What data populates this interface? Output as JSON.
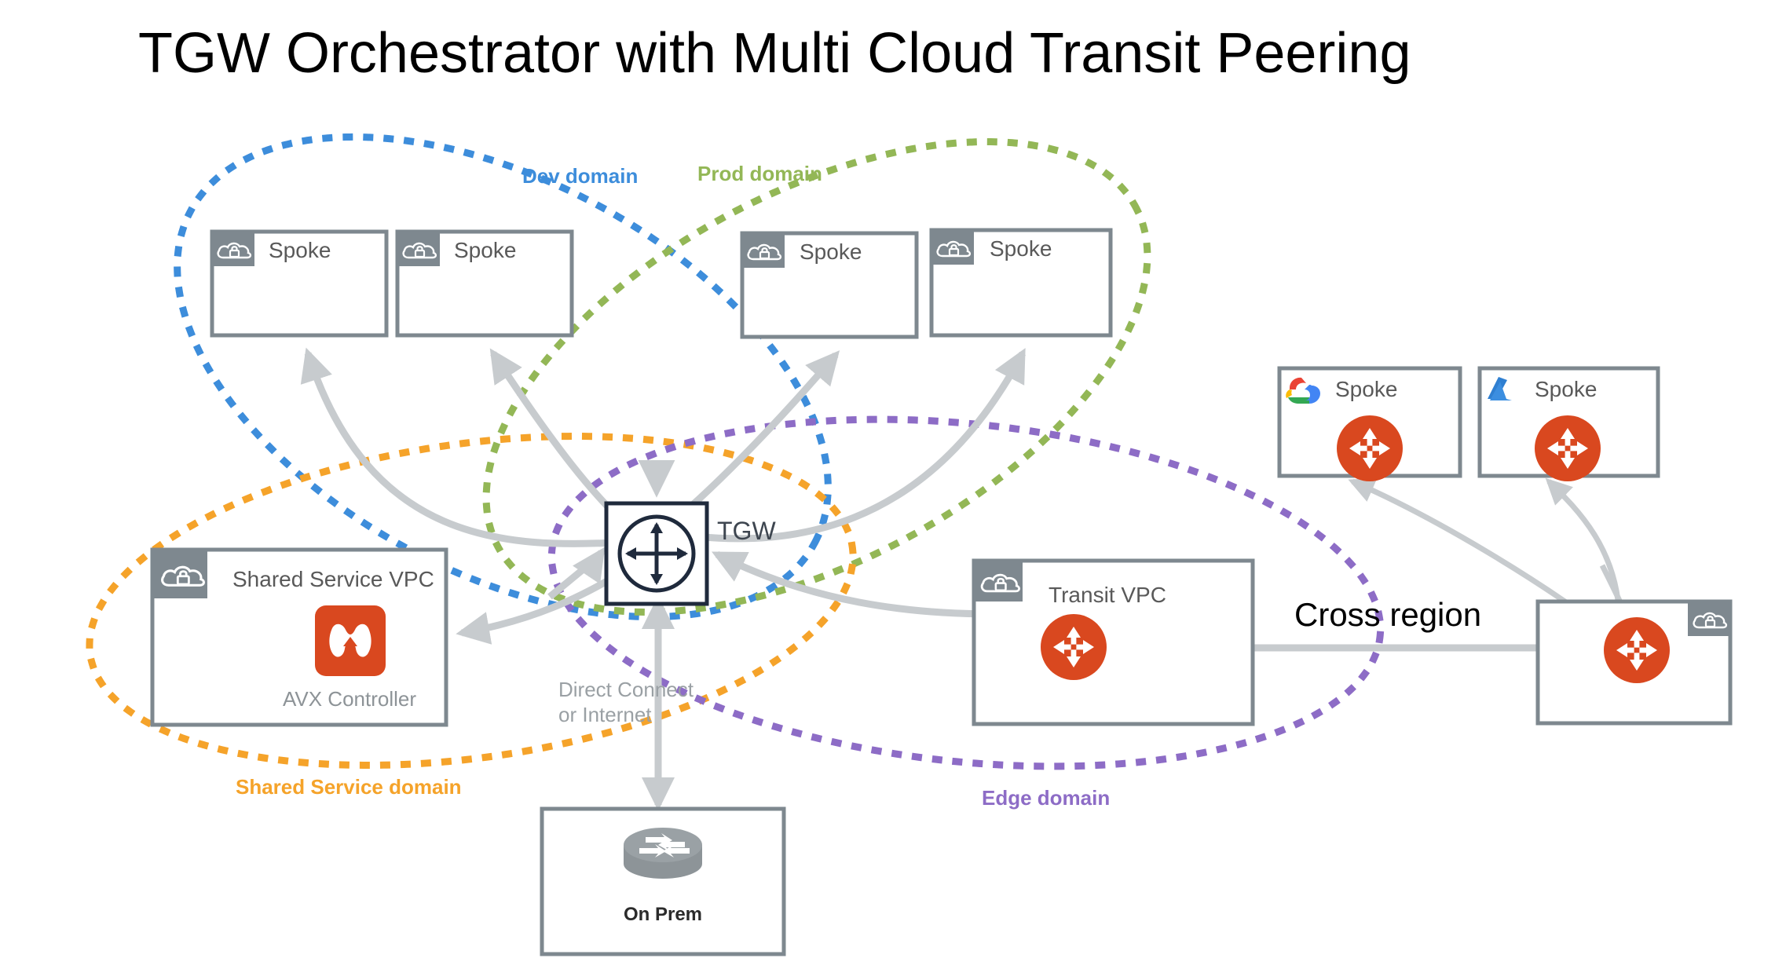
{
  "title": "TGW Orchestrator with Multi Cloud Transit Peering",
  "domains": [
    {
      "key": "dev",
      "label": "Dev domain",
      "color": "#3d8ddb"
    },
    {
      "key": "prod",
      "label": "Prod domain",
      "color": "#93b756"
    },
    {
      "key": "shared",
      "label": "Shared Service domain",
      "color": "#f5a32a"
    },
    {
      "key": "edge",
      "label": "Edge domain",
      "color": "#8d6cc6"
    }
  ],
  "nodes": {
    "dev_spoke_1": {
      "label": "Spoke",
      "icon": "aws-vpc-cloud-lock-icon"
    },
    "dev_spoke_2": {
      "label": "Spoke",
      "icon": "aws-vpc-cloud-lock-icon"
    },
    "prod_spoke_1": {
      "label": "Spoke",
      "icon": "aws-vpc-cloud-lock-icon"
    },
    "prod_spoke_2": {
      "label": "Spoke",
      "icon": "aws-vpc-cloud-lock-icon"
    },
    "gcp_spoke": {
      "label": "Spoke",
      "icon": "google-cloud-icon",
      "gateway": "aviatrix-gateway-icon"
    },
    "azure_spoke": {
      "label": "Spoke",
      "icon": "azure-icon",
      "gateway": "aviatrix-gateway-icon"
    },
    "remote_vpc": {
      "label": "",
      "icon": "aws-vpc-cloud-lock-icon",
      "gateway": "aviatrix-gateway-icon"
    },
    "shared_vpc": {
      "label": "Shared Service VPC",
      "icon": "aws-vpc-cloud-lock-icon",
      "caption": "AVX Controller",
      "app_icon": "aviatrix-controller-icon"
    },
    "transit_vpc": {
      "label": "Transit VPC",
      "icon": "aws-vpc-cloud-lock-icon",
      "gateway": "aviatrix-gateway-icon"
    },
    "tgw": {
      "label": "TGW",
      "icon": "transit-gateway-icon"
    },
    "on_prem": {
      "label": "On Prem",
      "icon": "router-icon"
    }
  },
  "annotations": {
    "direct_connect_line1": "Direct Connect",
    "direct_connect_line2": "or Internet",
    "cross_region": "Cross region"
  },
  "colors": {
    "aviatrix_orange": "#d9481f",
    "vpc_gray": "#7e888f",
    "arrow_gray": "#c7cbce",
    "tgw_navy": "#1f2a3c",
    "text_gray": "#595959",
    "caption_gray": "#8d9397"
  }
}
